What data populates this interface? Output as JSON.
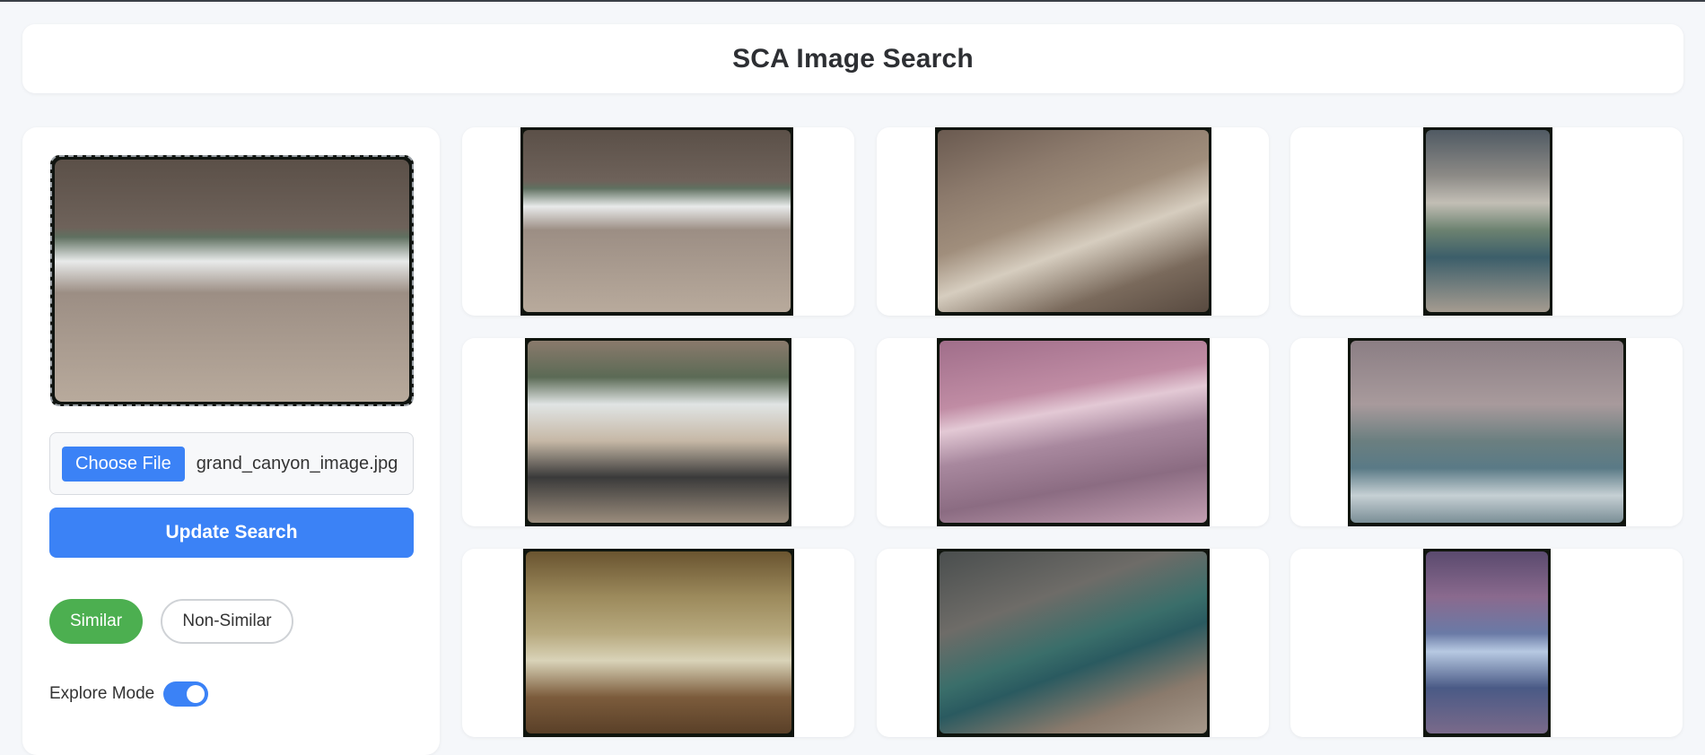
{
  "header": {
    "title": "SCA Image Search"
  },
  "sidebar": {
    "query_image_alt": "grand_canyon_image.jpg",
    "choose_file_label": "Choose File",
    "file_name": "grand_canyon_image.jpg",
    "update_button_label": "Update Search",
    "similar_label": "Similar",
    "non_similar_label": "Non-Similar",
    "explore_mode_label": "Explore Mode",
    "explore_mode_on": true
  },
  "results": {
    "count": 9
  },
  "colors": {
    "accent": "#3b82f6",
    "similar_active": "#4caf50",
    "page_bg": "#f5f7fa"
  }
}
